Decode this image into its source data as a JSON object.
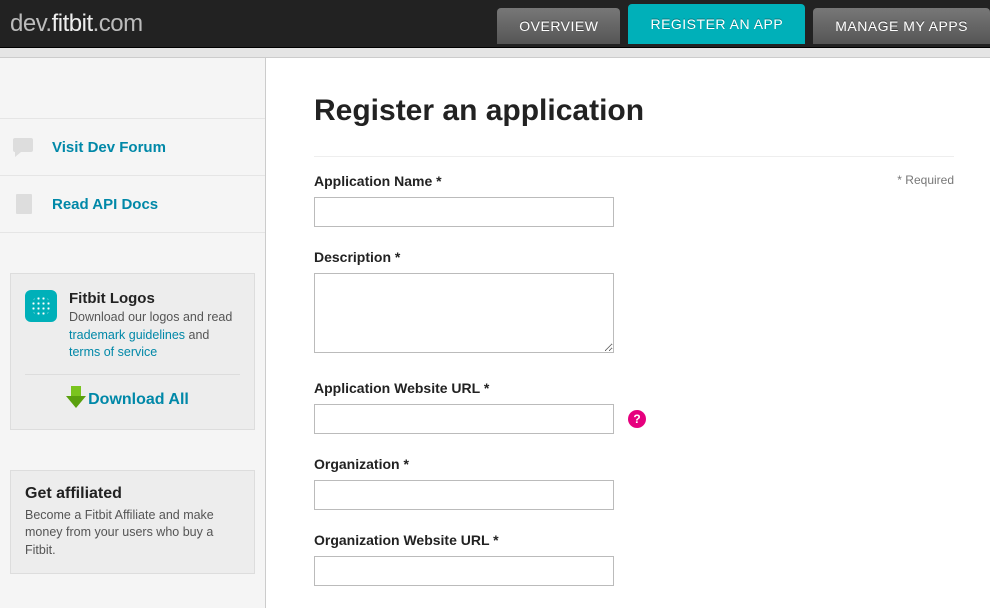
{
  "header": {
    "logo_dev": "dev.",
    "logo_brand": "fitbit",
    "logo_com": ".com",
    "tabs": {
      "overview": "OVERVIEW",
      "register": "REGISTER AN APP",
      "manage": "MANAGE MY APPS"
    }
  },
  "sidebar": {
    "forum_link": "Visit Dev Forum",
    "docs_link": "Read API Docs",
    "logos": {
      "title": "Fitbit Logos",
      "pre": "Download our logos and read ",
      "link1": "trademark guidelines",
      "mid": " and ",
      "link2": "terms of service",
      "download": "Download All"
    },
    "affiliate": {
      "title": "Get affiliated",
      "text": "Become a Fitbit Affiliate and make money from your users who buy a Fitbit."
    }
  },
  "main": {
    "title": "Register an application",
    "required_note": "* Required",
    "labels": {
      "app_name": "Application Name *",
      "description": "Description *",
      "app_url": "Application Website URL *",
      "org": "Organization *",
      "org_url": "Organization Website URL *"
    },
    "help": "?"
  }
}
